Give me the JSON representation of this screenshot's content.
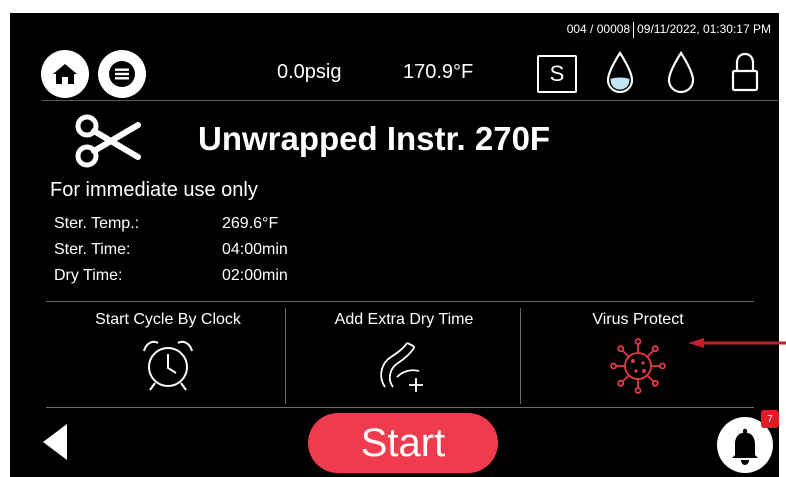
{
  "status": {
    "counter": "004 / 00008",
    "datetime": "09/11/2022, 01:30:17 PM"
  },
  "header": {
    "pressure": "0.0psig",
    "temperature": "170.9°F",
    "s_label": "S",
    "icons": [
      "home-icon",
      "menu-icon",
      "water-drop-filled-icon",
      "water-drop-outline-icon",
      "lock-icon"
    ]
  },
  "program": {
    "title": "Unwrapped Instr. 270F",
    "subtitle": "For immediate use only",
    "icon": "scissors-icon",
    "params": [
      {
        "label": "Ster. Temp.:",
        "value": "269.6°F"
      },
      {
        "label": "Ster. Time:",
        "value": "04:00min"
      },
      {
        "label": "Dry Time:",
        "value": "02:00min"
      }
    ]
  },
  "options": [
    {
      "label": "Start Cycle By Clock",
      "icon": "alarm-clock-icon"
    },
    {
      "label": "Add Extra Dry Time",
      "icon": "dry-add-icon"
    },
    {
      "label": "Virus Protect",
      "icon": "virus-icon",
      "color": "#e8394a"
    }
  ],
  "footer": {
    "start_label": "Start",
    "start_color": "#ef3b4d",
    "bell_badge": "7"
  }
}
